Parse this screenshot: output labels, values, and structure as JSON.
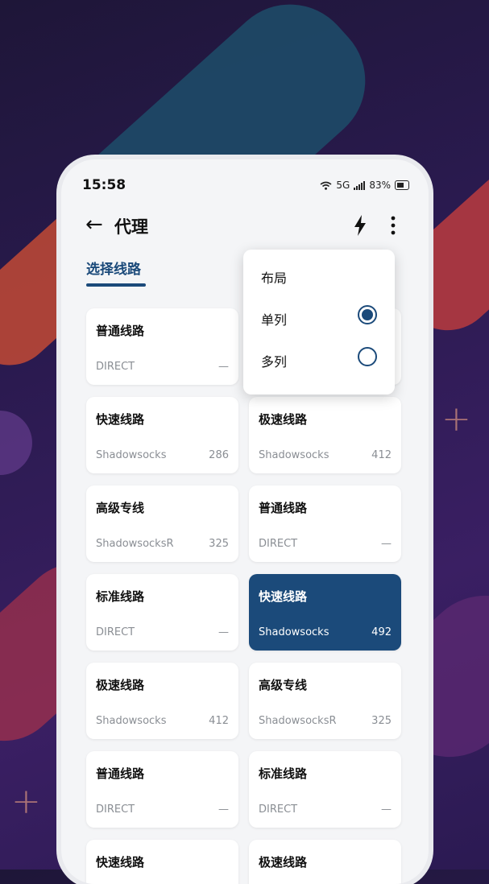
{
  "status": {
    "time": "15:58",
    "network": "5G",
    "battery": "83%"
  },
  "appbar": {
    "back_icon": "arrow-left-icon",
    "title": "代理",
    "speed_icon": "lightning-icon",
    "more_icon": "more-vert-icon"
  },
  "tabs": {
    "active": "选择线路"
  },
  "menu": {
    "header": "布局",
    "options": [
      {
        "label": "单列",
        "selected": true
      },
      {
        "label": "多列",
        "selected": false
      }
    ]
  },
  "cards": [
    {
      "name": "普通线路",
      "protocol": "DIRECT",
      "latency": "—"
    },
    {
      "name": "",
      "protocol": "",
      "latency": ""
    },
    {
      "name": "快速线路",
      "protocol": "Shadowsocks",
      "latency": "286"
    },
    {
      "name": "极速线路",
      "protocol": "Shadowsocks",
      "latency": "412"
    },
    {
      "name": "高级专线",
      "protocol": "ShadowsocksR",
      "latency": "325"
    },
    {
      "name": "普通线路",
      "protocol": "DIRECT",
      "latency": "—"
    },
    {
      "name": "标准线路",
      "protocol": "DIRECT",
      "latency": "—"
    },
    {
      "name": "快速线路",
      "protocol": "Shadowsocks",
      "latency": "492",
      "selected": true
    },
    {
      "name": "极速线路",
      "protocol": "Shadowsocks",
      "latency": "412"
    },
    {
      "name": "高级专线",
      "protocol": "ShadowsocksR",
      "latency": "325"
    },
    {
      "name": "普通线路",
      "protocol": "DIRECT",
      "latency": "—"
    },
    {
      "name": "标准线路",
      "protocol": "DIRECT",
      "latency": "—"
    },
    {
      "name": "快速线路",
      "protocol": "",
      "latency": ""
    },
    {
      "name": "极速线路",
      "protocol": "",
      "latency": ""
    }
  ],
  "colors": {
    "accent": "#1b4a7a",
    "background": "#f4f5f7"
  }
}
